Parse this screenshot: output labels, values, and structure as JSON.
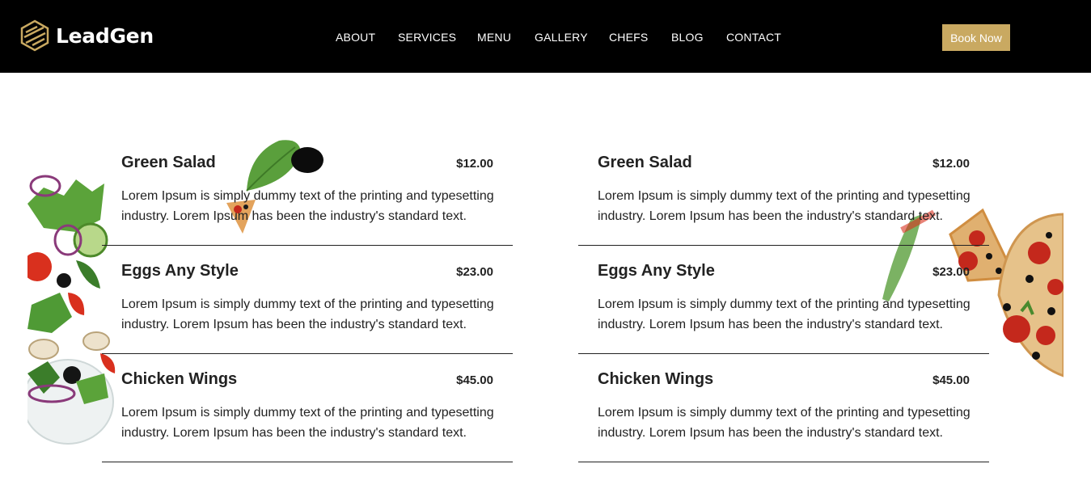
{
  "brand": {
    "name": "LeadGen"
  },
  "nav": {
    "links": [
      "ABOUT",
      "SERVICES",
      "MENU",
      "GALLERY",
      "CHEFS",
      "BLOG",
      "CONTACT"
    ],
    "cta": "Book Now"
  },
  "menu": {
    "left": [
      {
        "name": "Green Salad",
        "price": "$12.00",
        "description": "Lorem Ipsum is simply dummy text of the printing and typesetting industry. Lorem Ipsum has been the industry's standard text."
      },
      {
        "name": "Eggs Any Style",
        "price": "$23.00",
        "description": "Lorem Ipsum is simply dummy text of the printing and typesetting industry. Lorem Ipsum has been the industry's standard text."
      },
      {
        "name": "Chicken Wings",
        "price": "$45.00",
        "description": "Lorem Ipsum is simply dummy text of the printing and typesetting industry. Lorem Ipsum has been the industry's standard text."
      }
    ],
    "right": [
      {
        "name": "Green Salad",
        "price": "$12.00",
        "description": "Lorem Ipsum is simply dummy text of the printing and typesetting industry. Lorem Ipsum has been the industry's standard text."
      },
      {
        "name": "Eggs Any Style",
        "price": "$23.00",
        "description": "Lorem Ipsum is simply dummy text of the printing and typesetting industry. Lorem Ipsum has been the industry's standard text."
      },
      {
        "name": "Chicken Wings",
        "price": "$45.00",
        "description": "Lorem Ipsum is simply dummy text of the printing and typesetting industry. Lorem Ipsum has been the industry's standard text."
      }
    ]
  },
  "colors": {
    "navbar": "#000000",
    "accent": "#c9a961",
    "text": "#222222"
  },
  "icons": {
    "logo": "hexagon-logo-icon"
  }
}
